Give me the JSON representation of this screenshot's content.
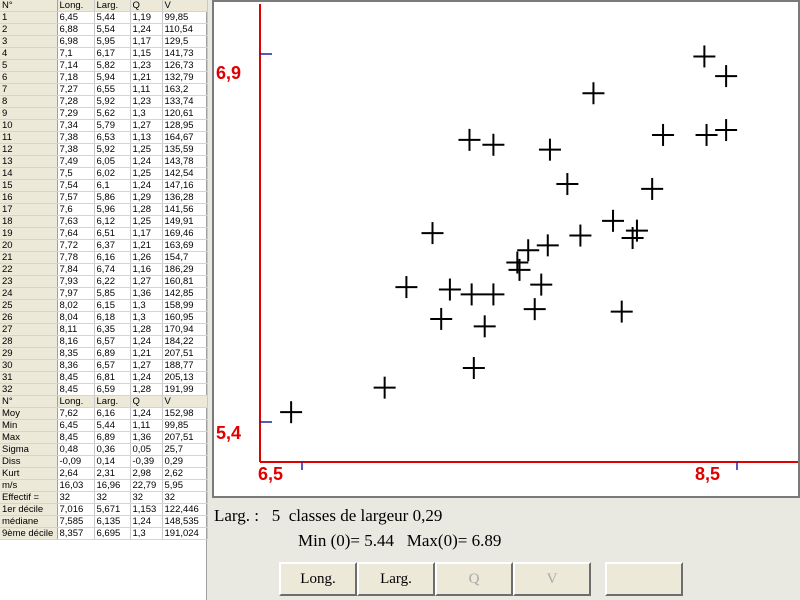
{
  "table": {
    "header": [
      "N°",
      "Long.",
      "Larg.",
      "Q",
      "V"
    ],
    "rows": [
      [
        "1",
        "6,45",
        "5,44",
        "1,19",
        "99,85"
      ],
      [
        "2",
        "6,88",
        "5,54",
        "1,24",
        "110,54"
      ],
      [
        "3",
        "6,98",
        "5,95",
        "1,17",
        "129,5"
      ],
      [
        "4",
        "7,1",
        "6,17",
        "1,15",
        "141,73"
      ],
      [
        "5",
        "7,14",
        "5,82",
        "1,23",
        "126,73"
      ],
      [
        "6",
        "7,18",
        "5,94",
        "1,21",
        "132,79"
      ],
      [
        "7",
        "7,27",
        "6,55",
        "1,11",
        "163,2"
      ],
      [
        "8",
        "7,28",
        "5,92",
        "1,23",
        "133,74"
      ],
      [
        "9",
        "7,29",
        "5,62",
        "1,3",
        "120,61"
      ],
      [
        "10",
        "7,34",
        "5,79",
        "1,27",
        "128,95"
      ],
      [
        "11",
        "7,38",
        "6,53",
        "1,13",
        "164,67"
      ],
      [
        "12",
        "7,38",
        "5,92",
        "1,25",
        "135,59"
      ],
      [
        "13",
        "7,49",
        "6,05",
        "1,24",
        "143,78"
      ],
      [
        "14",
        "7,5",
        "6,02",
        "1,25",
        "142,54"
      ],
      [
        "15",
        "7,54",
        "6,1",
        "1,24",
        "147,16"
      ],
      [
        "16",
        "7,57",
        "5,86",
        "1,29",
        "136,28"
      ],
      [
        "17",
        "7,6",
        "5,96",
        "1,28",
        "141,56"
      ],
      [
        "18",
        "7,63",
        "6,12",
        "1,25",
        "149,91"
      ],
      [
        "19",
        "7,64",
        "6,51",
        "1,17",
        "169,46"
      ],
      [
        "20",
        "7,72",
        "6,37",
        "1,21",
        "163,69"
      ],
      [
        "21",
        "7,78",
        "6,16",
        "1,26",
        "154,7"
      ],
      [
        "22",
        "7,84",
        "6,74",
        "1,16",
        "186,29"
      ],
      [
        "23",
        "7,93",
        "6,22",
        "1,27",
        "160,81"
      ],
      [
        "24",
        "7,97",
        "5,85",
        "1,36",
        "142,85"
      ],
      [
        "25",
        "8,02",
        "6,15",
        "1,3",
        "158,99"
      ],
      [
        "26",
        "8,04",
        "6,18",
        "1,3",
        "160,95"
      ],
      [
        "27",
        "8,11",
        "6,35",
        "1,28",
        "170,94"
      ],
      [
        "28",
        "8,16",
        "6,57",
        "1,24",
        "184,22"
      ],
      [
        "29",
        "8,35",
        "6,89",
        "1,21",
        "207,51"
      ],
      [
        "30",
        "8,36",
        "6,57",
        "1,27",
        "188,77"
      ],
      [
        "31",
        "8,45",
        "6,81",
        "1,24",
        "205,13"
      ],
      [
        "32",
        "8,45",
        "6,59",
        "1,28",
        "191,99"
      ]
    ],
    "header2": [
      "N°",
      "Long.",
      "Larg.",
      "Q",
      "V"
    ],
    "stats": [
      [
        "Moy",
        "7,62",
        "6,16",
        "1,24",
        "152,98"
      ],
      [
        "Min",
        "6,45",
        "5,44",
        "1,11",
        "99,85"
      ],
      [
        "Max",
        "8,45",
        "6,89",
        "1,36",
        "207,51"
      ],
      [
        "Sigma",
        "0,48",
        "0,36",
        "0,05",
        "25,7"
      ],
      [
        "Diss",
        "-0,09",
        "0,14",
        "-0,39",
        "0,29"
      ],
      [
        "Kurt",
        "2,64",
        "2,31",
        "2,98",
        "2,62"
      ],
      [
        "m/s",
        "16,03",
        "16,96",
        "22,79",
        "5,95"
      ],
      [
        "Effectif =",
        "32",
        "32",
        "32",
        "32"
      ],
      [
        "1er décile",
        "7,016",
        "5,671",
        "1,153",
        "122,446"
      ],
      [
        "médiane",
        "7,585",
        "6,135",
        "1,24",
        "148,535"
      ],
      [
        "9ème décile",
        "8,357",
        "6,695",
        "1,3",
        "191,024"
      ]
    ]
  },
  "chart_data": {
    "type": "scatter",
    "x_min_label": "6,5",
    "x_max_label": "8,5",
    "y_min_label": "5,4",
    "y_max_label": "6,9",
    "xlim": [
      6.5,
      8.5
    ],
    "ylim": [
      5.4,
      6.9
    ],
    "points": [
      [
        6.45,
        5.44
      ],
      [
        6.88,
        5.54
      ],
      [
        6.98,
        5.95
      ],
      [
        7.1,
        6.17
      ],
      [
        7.14,
        5.82
      ],
      [
        7.18,
        5.94
      ],
      [
        7.27,
        6.55
      ],
      [
        7.28,
        5.92
      ],
      [
        7.29,
        5.62
      ],
      [
        7.34,
        5.79
      ],
      [
        7.38,
        6.53
      ],
      [
        7.38,
        5.92
      ],
      [
        7.49,
        6.05
      ],
      [
        7.5,
        6.02
      ],
      [
        7.54,
        6.1
      ],
      [
        7.57,
        5.86
      ],
      [
        7.6,
        5.96
      ],
      [
        7.63,
        6.12
      ],
      [
        7.64,
        6.51
      ],
      [
        7.72,
        6.37
      ],
      [
        7.78,
        6.16
      ],
      [
        7.84,
        6.74
      ],
      [
        7.93,
        6.22
      ],
      [
        7.97,
        5.85
      ],
      [
        8.02,
        6.15
      ],
      [
        8.04,
        6.18
      ],
      [
        8.11,
        6.35
      ],
      [
        8.16,
        6.57
      ],
      [
        8.35,
        6.89
      ],
      [
        8.36,
        6.57
      ],
      [
        8.45,
        6.81
      ],
      [
        8.45,
        6.59
      ]
    ],
    "axis_color": "#e00000",
    "marker_color": "#000000",
    "tick_mark_color": "#2020a0"
  },
  "info": {
    "line1": "Larg. :   5  classes de largeur 0,29",
    "line2": "Min (0)= 5.44   Max(0)= 6.89"
  },
  "buttons": [
    {
      "label": "Long.",
      "enabled": true
    },
    {
      "label": "Larg.",
      "enabled": true
    },
    {
      "label": "Q",
      "enabled": false
    },
    {
      "label": "V",
      "enabled": false
    },
    {
      "label": "",
      "enabled": true
    }
  ]
}
